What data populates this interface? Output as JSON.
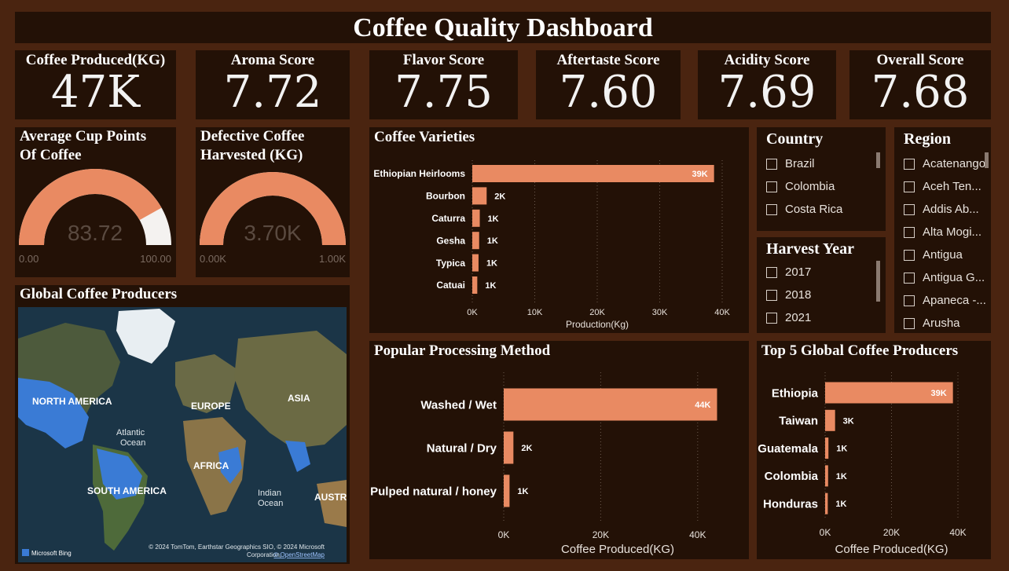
{
  "title": "Coffee Quality Dashboard",
  "kpis": [
    {
      "label": "Coffee Produced(KG)",
      "value": "47K"
    },
    {
      "label": "Aroma Score",
      "value": "7.72"
    },
    {
      "label": "Flavor Score",
      "value": "7.75"
    },
    {
      "label": "Aftertaste Score",
      "value": "7.60"
    },
    {
      "label": "Acidity Score",
      "value": "7.69"
    },
    {
      "label": "Overall Score",
      "value": "7.68"
    }
  ],
  "gauges": [
    {
      "title_line1": "Average Cup Points",
      "title_line2": "Of Coffee",
      "value_label": "83.72",
      "value": 83.72,
      "min": 0,
      "max": 100,
      "min_label": "0.00",
      "max_label": "100.00"
    },
    {
      "title_line1": "Defective Coffee",
      "title_line2": "Harvested (KG)",
      "value_label": "3.70K",
      "value": 3700,
      "min": 0,
      "max": 1000,
      "min_label": "0.00K",
      "max_label": "1.00K"
    }
  ],
  "map": {
    "title": "Global Coffee Producers",
    "labels": {
      "north_america": "NORTH AMERICA",
      "europe": "EUROPE",
      "asia": "ASIA",
      "atlantic": "Atlantic",
      "atlantic2": "Ocean",
      "africa": "AFRICA",
      "south_america": "SOUTH AMERICA",
      "indian": "Indian",
      "indian2": "Ocean",
      "australia": "AUSTRA"
    },
    "attribution1": "© 2024 TomTom, Earthstar Geographics SIO, © 2024 Microsoft",
    "attribution2": "Corporation,",
    "attribution_link": "© OpenStreetMap",
    "brand": "Microsoft Bing"
  },
  "slicers": {
    "country": {
      "title": "Country",
      "items": [
        "Brazil",
        "Colombia",
        "Costa Rica"
      ]
    },
    "harvest_year": {
      "title": "Harvest Year",
      "items": [
        "2017",
        "2018",
        "2021"
      ]
    },
    "region": {
      "title": "Region",
      "items": [
        "Acatenango",
        "Aceh Ten...",
        "Addis Ab...",
        "Alta Mogi...",
        "Antigua",
        "Antigua G...",
        "Apaneca -...",
        "Arusha"
      ]
    }
  },
  "colors": {
    "bar": "#e98a62",
    "panel": "#231106",
    "background": "#4a2410",
    "ocean": "#1d3a4e",
    "highlight": "#3a7bd5"
  },
  "chart_data": [
    {
      "id": "varieties",
      "type": "bar",
      "orientation": "horizontal",
      "title": "Coffee Varieties",
      "xlabel": "Production(Kg)",
      "categories": [
        "Ethiopian Heirlooms",
        "Bourbon",
        "Caturra",
        "Gesha",
        "Typica",
        "Catuai"
      ],
      "values": [
        38700,
        2300,
        1200,
        1100,
        1000,
        800
      ],
      "data_labels": [
        "39K",
        "2K",
        "1K",
        "1K",
        "1K",
        "1K"
      ],
      "xlim": [
        0,
        40000
      ],
      "ticks": [
        0,
        10000,
        20000,
        30000,
        40000
      ],
      "tick_labels": [
        "0K",
        "10K",
        "20K",
        "30K",
        "40K"
      ],
      "grid": true
    },
    {
      "id": "processing",
      "type": "bar",
      "orientation": "horizontal",
      "title": "Popular Processing Method",
      "xlabel": "Coffee Produced(KG)",
      "categories": [
        "Washed / Wet",
        "Natural / Dry",
        "Pulped natural / honey"
      ],
      "values": [
        44000,
        2000,
        1200
      ],
      "data_labels": [
        "44K",
        "2K",
        "1K"
      ],
      "xlim": [
        0,
        47000
      ],
      "ticks": [
        0,
        20000,
        40000
      ],
      "tick_labels": [
        "0K",
        "20K",
        "40K"
      ],
      "grid": true
    },
    {
      "id": "top5",
      "type": "bar",
      "orientation": "horizontal",
      "title": "Top 5 Global Coffee Producers",
      "xlabel": "Coffee Produced(KG)",
      "categories": [
        "Ethiopia",
        "Taiwan",
        "Guatemala",
        "Colombia",
        "Honduras"
      ],
      "values": [
        38500,
        3000,
        1000,
        900,
        800
      ],
      "data_labels": [
        "39K",
        "3K",
        "1K",
        "1K",
        "1K"
      ],
      "xlim": [
        0,
        40000
      ],
      "ticks": [
        0,
        20000,
        40000
      ],
      "tick_labels": [
        "0K",
        "20K",
        "40K"
      ],
      "grid": true
    }
  ]
}
